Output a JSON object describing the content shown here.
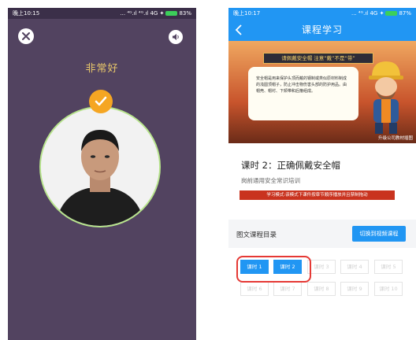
{
  "left_screen": {
    "status_bar": {
      "time": "晚上10:15",
      "indicators": "... ⁴ᴳ.ıl ⁴ᴳ.ıl 4G ✦",
      "battery": "83%"
    },
    "close_icon": "close-icon",
    "speaker_icon": "speaker-icon",
    "praise_text": "非常好",
    "check_icon": "check-icon",
    "colors": {
      "background": "#524360",
      "praise": "#e8c76a",
      "badge": "#f5a623",
      "ring": "#b7e48c"
    }
  },
  "right_screen": {
    "status_bar": {
      "time": "晚上10:17",
      "indicators": "... ⁴ᴳ.ıl 4G ✦",
      "battery": "87%"
    },
    "header": {
      "title": "课程学习",
      "back_icon": "back-arrow-icon"
    },
    "banner": {
      "title": "请佩戴安全帽 注意“戴”不是“带”",
      "body": "安全帽是用来保护头顶而戴的钢制或类似原材料制成的浅圆顶帽子，防止冲击物伤害头部的防护用品。由帽壳、帽衬、下颏带和后箍组成。",
      "watermark": "升级公司教材插图"
    },
    "lesson": {
      "title": "课时 2：正确佩戴安全帽",
      "course": "岗前通用安全常识培训",
      "mode_notice": "学习模式:该模式下课件按章节顺序播放并且禁制拖动"
    },
    "catalog": {
      "label": "图文课程目录",
      "switch_button": "切换到视频课程"
    },
    "lessons": [
      {
        "label": "课时 1",
        "active": true
      },
      {
        "label": "课时 2",
        "active": true
      },
      {
        "label": "课时 3",
        "active": false
      },
      {
        "label": "课时 4",
        "active": false
      },
      {
        "label": "课时 5",
        "active": false
      },
      {
        "label": "课时 6",
        "active": false
      },
      {
        "label": "课时 7",
        "active": false
      },
      {
        "label": "课时 8",
        "active": false
      },
      {
        "label": "课时 9",
        "active": false
      },
      {
        "label": "课时 10",
        "active": false
      }
    ],
    "colors": {
      "primary": "#2196f3",
      "notice": "#c9331f",
      "highlight": "#e53935"
    }
  }
}
